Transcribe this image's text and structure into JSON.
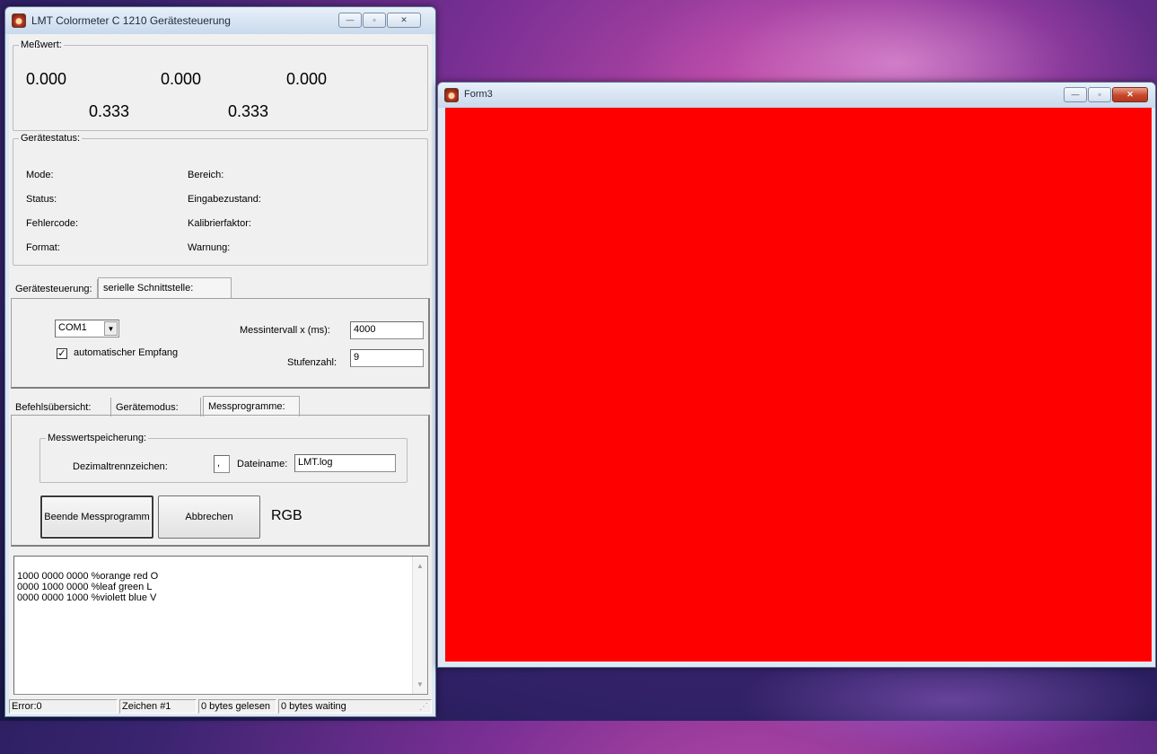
{
  "main_window": {
    "title": "LMT Colormeter C 1210 Gerätesteuerung",
    "messwert": {
      "title": "Meßwert:",
      "row1": [
        "0.000",
        "0.000",
        "0.000"
      ],
      "row2": [
        "0.333",
        "0.333"
      ]
    },
    "geraetestatus": {
      "title": "Gerätestatus:",
      "left": [
        "Mode:",
        "Status:",
        "Fehlercode:",
        "Format:"
      ],
      "right": [
        "Bereich:",
        "Eingabezustand:",
        "Kalibrierfaktor:",
        "Warnung:"
      ]
    },
    "tabs1": {
      "items": [
        "Gerätesteuerung:",
        "serielle Schnittstelle:"
      ],
      "port": "COM1",
      "auto_receive_label": "automatischer Empfang",
      "auto_receive_checked": "✓",
      "interval_label": "Messintervall x (ms):",
      "interval_value": "4000",
      "steps_label": "Stufenzahl:",
      "steps_value": "9"
    },
    "tabs2": {
      "items": [
        "Befehlsübersicht:",
        "Gerätemodus:",
        "Messprogramme:"
      ],
      "storage_title": "Messwertspeicherung:",
      "decimal_label": "Dezimaltrennzeichen:",
      "decimal_value": ",",
      "filename_label": "Dateiname:",
      "filename_value": "LMT.log",
      "stop_button": "Beende Messprogramm",
      "cancel_button": "Abbrechen",
      "mode_text": "RGB"
    },
    "log_lines": "1000 0000 0000 %orange red O\n0000 1000 0000 %leaf green L\n0000 0000 1000 %violett blue V",
    "statusbar": [
      "Error:0",
      "Zeichen #1",
      "0 bytes gelesen",
      "0 bytes waiting"
    ]
  },
  "form3": {
    "title": "Form3",
    "fill_color": "#ff0000"
  },
  "icons": {
    "minimize": "—",
    "maximize": "▫",
    "close": "✕",
    "dropdown": "▼",
    "scroll_up": "▲",
    "scroll_down": "▼",
    "grip": "⋰"
  }
}
